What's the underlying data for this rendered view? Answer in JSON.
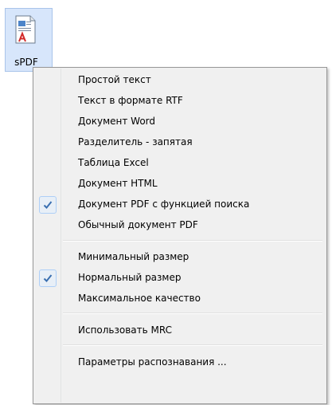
{
  "app": {
    "label": "sPDF",
    "icon": "sPDF-document-icon"
  },
  "menu": {
    "items": [
      {
        "label": "Простой текст",
        "checked": false
      },
      {
        "label": "Текст в формате RTF",
        "checked": false
      },
      {
        "label": "Документ Word",
        "checked": false
      },
      {
        "label": "Разделитель - запятая",
        "checked": false
      },
      {
        "label": "Таблица Excel",
        "checked": false
      },
      {
        "label": "Документ HTML",
        "checked": false
      },
      {
        "label": "Документ PDF с функцией поиска",
        "checked": true
      },
      {
        "label": "Обычный документ PDF",
        "checked": false
      },
      {
        "label": "Минимальный размер",
        "checked": false
      },
      {
        "label": "Нормальный размер",
        "checked": true
      },
      {
        "label": "Максимальное качество",
        "checked": false
      },
      {
        "label": "Использовать MRC",
        "checked": false
      },
      {
        "label": "Параметры распознавания ...",
        "checked": false
      }
    ],
    "check_icon": "checkmark-icon",
    "check_color": "#3a6fb0"
  }
}
